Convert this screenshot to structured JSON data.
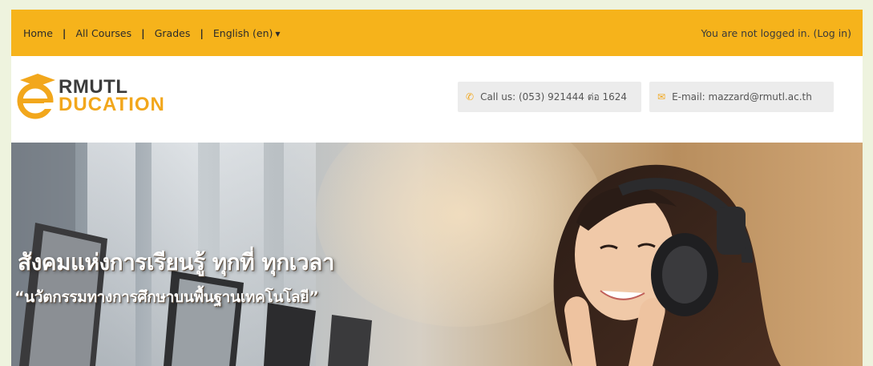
{
  "nav": {
    "items": [
      {
        "label": "Home"
      },
      {
        "label": "All Courses"
      },
      {
        "label": "Grades"
      },
      {
        "label": "English (en)"
      }
    ],
    "separator": "|",
    "login_text": "You are not logged in. (",
    "login_link": "Log in",
    "login_close": ")"
  },
  "logo": {
    "line1": "RMUTL",
    "line2": "DUCATION"
  },
  "contact": {
    "call_label": "Call us: (053) 921444 ต่อ 1624",
    "email_label": "E-mail: mazzard@rmutl.ac.th"
  },
  "hero": {
    "title": "สังคมแห่งการเรียนรู้ ทุกที่ ทุกเวลา",
    "subtitle": "“นวัตกรรมทางการศึกษาบนพื้นฐานเทคโนโลยี”"
  },
  "colors": {
    "accent": "#f6b31b",
    "logo_orange": "#f2a71c"
  }
}
